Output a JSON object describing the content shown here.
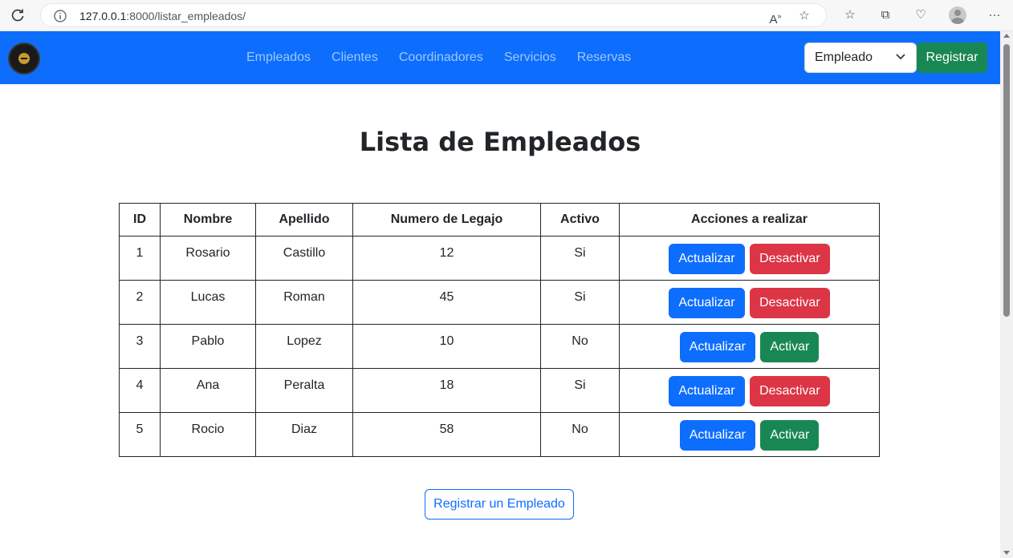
{
  "browser": {
    "url_host": "127.0.0.1",
    "url_rest": ":8000/listar_empleados/"
  },
  "navbar": {
    "links": [
      "Empleados",
      "Clientes",
      "Coordinadores",
      "Servicios",
      "Reservas"
    ],
    "select_value": "Empleado",
    "register_label": "Registrar"
  },
  "page": {
    "title": "Lista de Empleados",
    "bottom_button": "Registrar un Empleado"
  },
  "table": {
    "headers": [
      "ID",
      "Nombre",
      "Apellido",
      "Numero de Legajo",
      "Activo",
      "Acciones a realizar"
    ],
    "rows": [
      {
        "id": "1",
        "nombre": "Rosario",
        "apellido": "Castillo",
        "legajo": "12",
        "activo": "Si",
        "update": "Actualizar",
        "toggle": "Desactivar"
      },
      {
        "id": "2",
        "nombre": "Lucas",
        "apellido": "Roman",
        "legajo": "45",
        "activo": "Si",
        "update": "Actualizar",
        "toggle": "Desactivar"
      },
      {
        "id": "3",
        "nombre": "Pablo",
        "apellido": "Lopez",
        "legajo": "10",
        "activo": "No",
        "update": "Actualizar",
        "toggle": "Activar"
      },
      {
        "id": "4",
        "nombre": "Ana",
        "apellido": "Peralta",
        "legajo": "18",
        "activo": "Si",
        "update": "Actualizar",
        "toggle": "Desactivar"
      },
      {
        "id": "5",
        "nombre": "Rocio",
        "apellido": "Diaz",
        "legajo": "58",
        "activo": "No",
        "update": "Actualizar",
        "toggle": "Activar"
      }
    ]
  },
  "colors": {
    "primary": "#0d6efd",
    "danger": "#dc3545",
    "success": "#198754"
  }
}
